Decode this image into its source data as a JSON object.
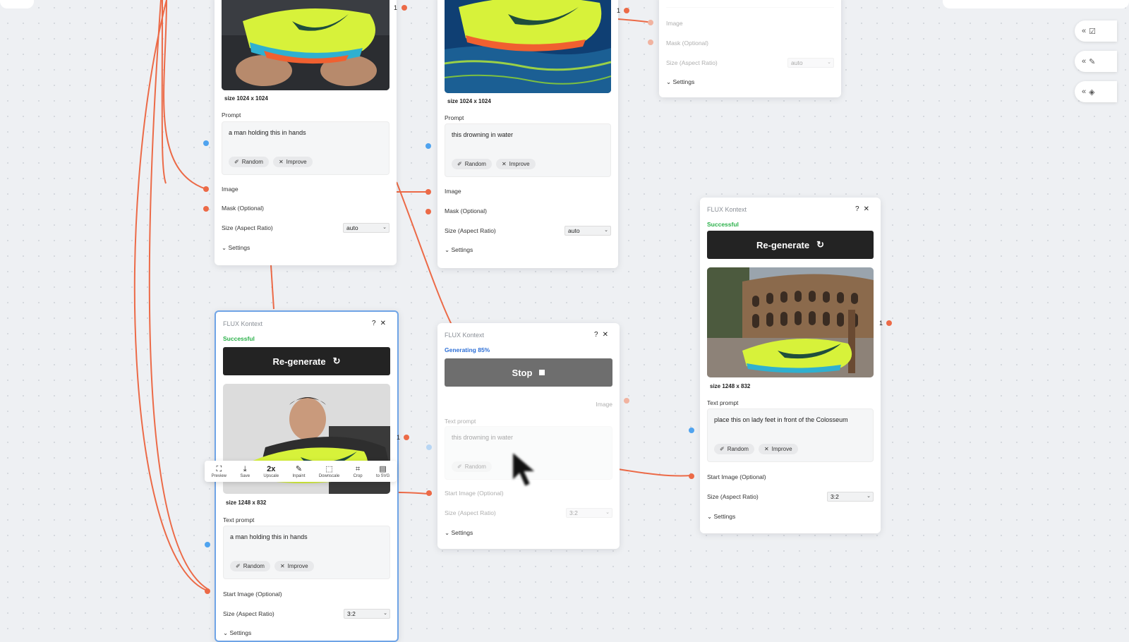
{
  "colors": {
    "wire": "#ec6a47",
    "accent_blue": "#6fa4e6",
    "success": "#2bb14a",
    "generating": "#2d6fd6",
    "button_dark": "#232323"
  },
  "nodes": {
    "n1": {
      "image_alt": "man holding sneaker",
      "size_label": "size 1024 x 1024",
      "prompt_label": "Prompt",
      "prompt_text": "a man holding this in hands",
      "random": "Random",
      "improve": "Improve",
      "image_label": "Image",
      "mask_label": "Mask (Optional)",
      "size_ratio_label": "Size (Aspect Ratio)",
      "size_value": "auto",
      "settings": "Settings",
      "port_count": "1"
    },
    "n2": {
      "image_alt": "sneaker in water",
      "size_label": "size 1024 x 1024",
      "prompt_label": "Prompt",
      "prompt_text": "this drowning in water",
      "random": "Random",
      "improve": "Improve",
      "image_label": "Image",
      "mask_label": "Mask (Optional)",
      "size_ratio_label": "Size (Aspect Ratio)",
      "size_value": "auto",
      "settings": "Settings",
      "port_count": "1"
    },
    "n3": {
      "image_label": "Image",
      "mask_label": "Mask (Optional)",
      "size_ratio_label": "Size (Aspect Ratio)",
      "size_value": "auto",
      "settings": "Settings"
    },
    "n4": {
      "title": "FLUX Kontext",
      "help": "?",
      "close": "✕",
      "status": "Successful",
      "button": "Re-generate",
      "size_label": "size 1248 x 832",
      "text_prompt_label": "Text prompt",
      "prompt_text": "a man holding this in hands",
      "random": "Random",
      "improve": "Improve",
      "start_image_label": "Start Image (Optional)",
      "size_ratio_label": "Size (Aspect Ratio)",
      "size_value": "3:2",
      "settings": "Settings",
      "port_count": "1"
    },
    "n5": {
      "title": "FLUX Kontext",
      "help": "?",
      "close": "✕",
      "status": "Generating 85%",
      "progress": 0.85,
      "button": "Stop",
      "image_label": "Image",
      "text_prompt_label": "Text prompt",
      "prompt_text": "this drowning in water",
      "random": "Random",
      "start_image_label": "Start Image (Optional)",
      "size_ratio_label": "Size (Aspect Ratio)",
      "size_value": "3:2",
      "settings": "Settings"
    },
    "n6": {
      "title": "FLUX Kontext",
      "help": "?",
      "close": "✕",
      "status": "Successful",
      "button": "Re-generate",
      "size_label": "size 1248 x 832",
      "text_prompt_label": "Text prompt",
      "prompt_text": "place this on lady feet in front of the Colosseum",
      "random": "Random",
      "improve": "Improve",
      "start_image_label": "Start Image (Optional)",
      "size_ratio_label": "Size (Aspect Ratio)",
      "size_value": "3:2",
      "settings": "Settings",
      "port_count": "1"
    }
  },
  "toolbar": {
    "items": [
      {
        "icon": "⛶",
        "label": "Preview"
      },
      {
        "icon": "⤓",
        "label": "Save"
      },
      {
        "icon": "2x",
        "label": "Upscale"
      },
      {
        "icon": "✎",
        "label": "Inpaint"
      },
      {
        "icon": "⬚",
        "label": "Downscale"
      },
      {
        "icon": "⌗",
        "label": "Crop"
      },
      {
        "icon": "▤",
        "label": "to SVG"
      }
    ]
  },
  "right_panel": {
    "chevron": "«"
  }
}
